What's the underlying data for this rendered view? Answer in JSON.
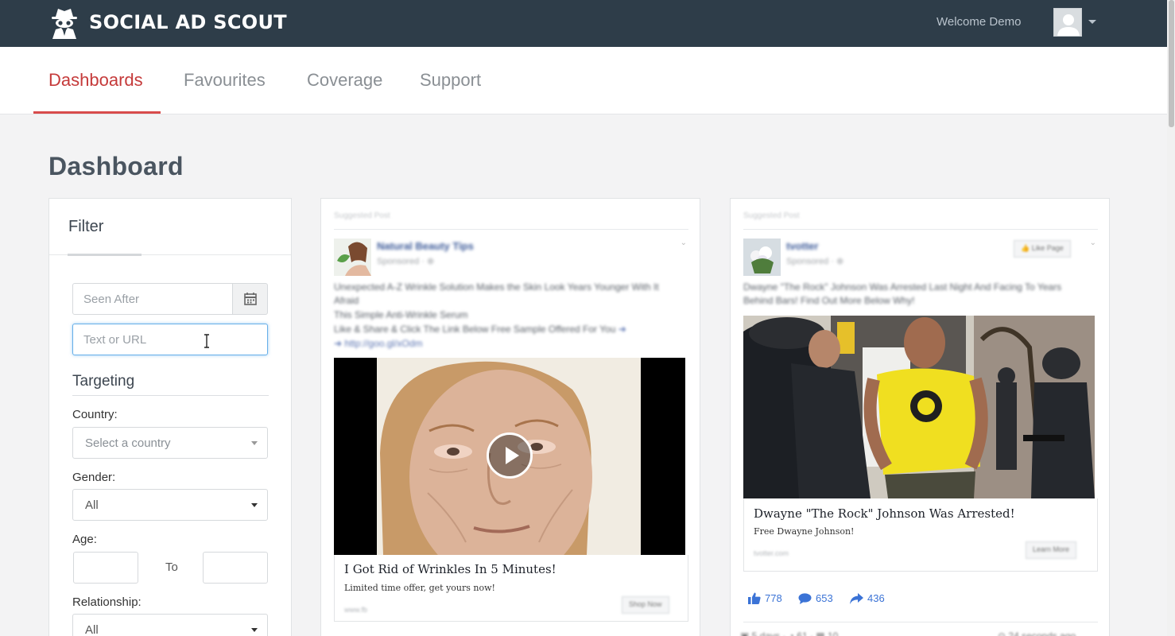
{
  "app": {
    "logo_text": "SOCIAL AD SCOUT",
    "welcome": "Welcome Demo"
  },
  "nav": {
    "tabs": [
      {
        "label": "Dashboards",
        "active": true
      },
      {
        "label": "Favourites",
        "active": false
      },
      {
        "label": "Coverage",
        "active": false
      },
      {
        "label": "Support",
        "active": false
      }
    ]
  },
  "page": {
    "title": "Dashboard"
  },
  "filter": {
    "title": "Filter",
    "seen_after_placeholder": "Seen After",
    "text_placeholder": "Text or URL",
    "targeting_title": "Targeting",
    "country_label": "Country:",
    "country_placeholder": "Select a country",
    "gender_label": "Gender:",
    "gender_value": "All",
    "age_label": "Age:",
    "age_to": "To",
    "relationship_label": "Relationship:",
    "relationship_value": "All"
  },
  "ads": [
    {
      "headline": "I Got Rid of Wrinkles In 5 Minutes!",
      "description": "Limited time offer, get yours now!",
      "media": "video"
    },
    {
      "headline": "Dwayne \"The Rock\" Johnson Was Arrested!",
      "description": "Free Dwayne Johnson!",
      "media": "image",
      "stats": {
        "likes": "778",
        "comments": "653",
        "shares": "436"
      }
    }
  ],
  "colors": {
    "topbar": "#2e3d49",
    "accent_red": "#c53a3a",
    "link_blue": "#3b73d6"
  }
}
